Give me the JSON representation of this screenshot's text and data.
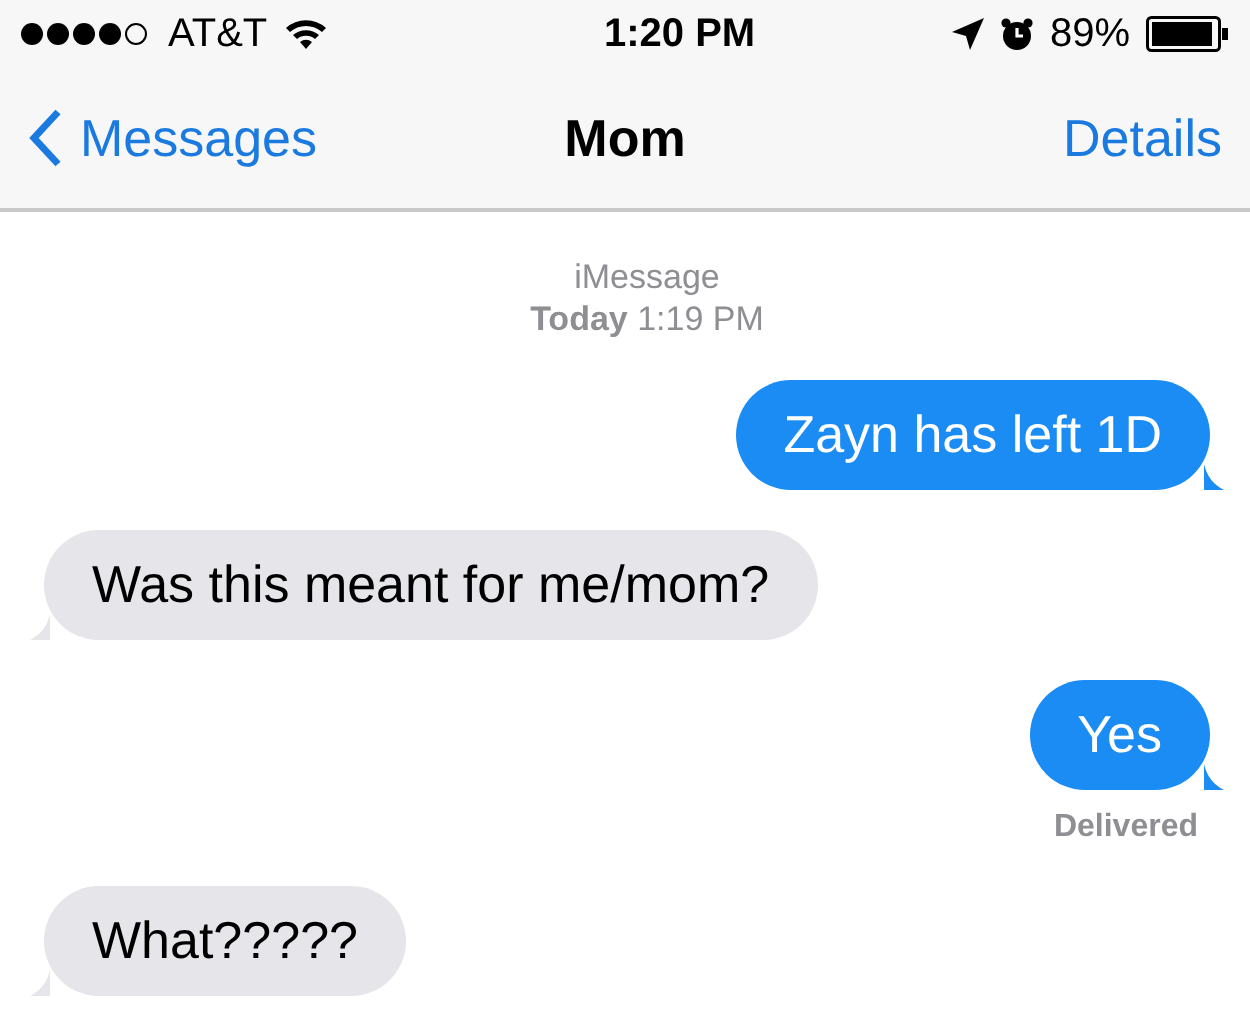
{
  "status_bar": {
    "carrier": "AT&T",
    "time": "1:20 PM",
    "battery": "89%"
  },
  "nav": {
    "back": "Messages",
    "title": "Mom",
    "action": "Details"
  },
  "header": {
    "service": "iMessage",
    "timestamp": "**Today** 1:19 PM"
  },
  "messages": [
    {
      "kind": "sent",
      "text": "Zayn has left 1D"
    },
    {
      "kind": "received",
      "text": "Was this meant for me/mom?"
    },
    {
      "kind": "sent",
      "text": "Yes",
      "status": "Delivered"
    },
    {
      "kind": "received",
      "text": "What?????"
    }
  ]
}
